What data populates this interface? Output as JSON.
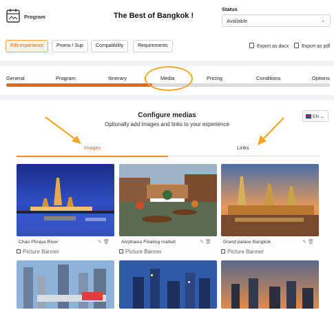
{
  "header": {
    "section_label": "Program",
    "title": "The Best of Bangkok !",
    "status_label": "Status",
    "status_value": "Available"
  },
  "toolbar": {
    "buttons": [
      "Edit experience",
      "Promo / Sup",
      "Compatibility",
      "Requirements"
    ],
    "export_docx": "Export as docx",
    "export_pdf": "Export as pdf"
  },
  "steps": {
    "labels": [
      "General",
      "Program",
      "Itinerary",
      "Media",
      "Pricing",
      "Conditions",
      "Options"
    ],
    "progress_fraction": 0.45
  },
  "media": {
    "title": "Configure medias",
    "subtitle": "Optionally add images and links to your experience",
    "language": "EN",
    "tabs": [
      "Images",
      "Links"
    ],
    "active_tab": "Images",
    "cards": [
      {
        "caption": "Chao Phraya River",
        "banner": "Picture Banner"
      },
      {
        "caption": "Amphawa Floating market",
        "banner": "Picture Banner"
      },
      {
        "caption": "Grand palace Bangkok",
        "banner": "Picture Banner"
      }
    ]
  },
  "colors": {
    "accent": "#e8681a",
    "annotation": "#f5a623"
  }
}
